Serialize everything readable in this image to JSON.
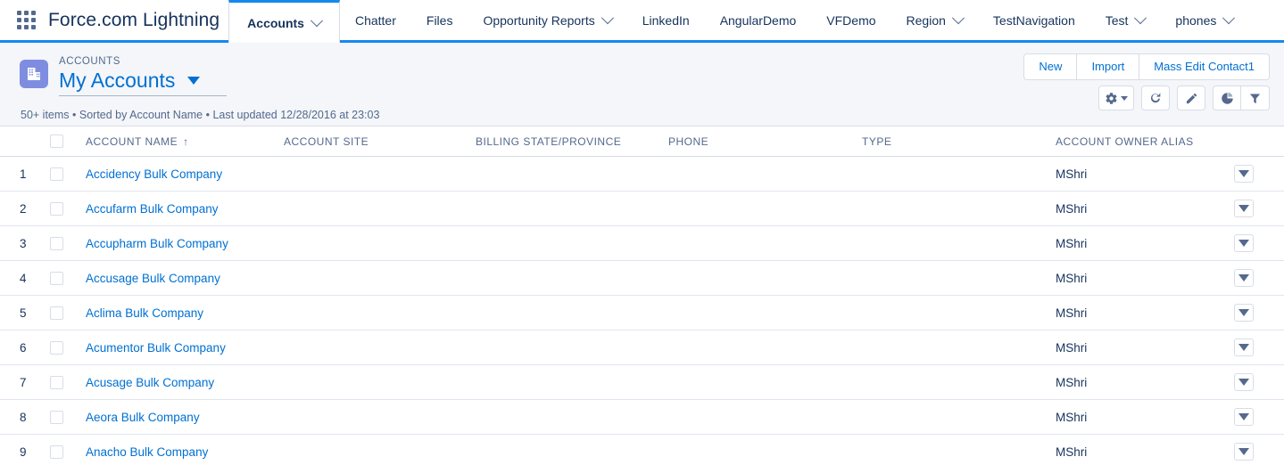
{
  "globalnav": {
    "app_launcher_icon": "app-launcher-grid-icon",
    "brand": "Force.com Lightning",
    "tabs": [
      {
        "label": "Accounts",
        "has_menu": true,
        "active": true
      },
      {
        "label": "Chatter",
        "has_menu": false,
        "active": false
      },
      {
        "label": "Files",
        "has_menu": false,
        "active": false
      },
      {
        "label": "Opportunity Reports",
        "has_menu": true,
        "active": false
      },
      {
        "label": "LinkedIn",
        "has_menu": false,
        "active": false
      },
      {
        "label": "AngularDemo",
        "has_menu": false,
        "active": false
      },
      {
        "label": "VFDemo",
        "has_menu": false,
        "active": false
      },
      {
        "label": "Region",
        "has_menu": true,
        "active": false
      },
      {
        "label": "TestNavigation",
        "has_menu": false,
        "active": false
      },
      {
        "label": "Test",
        "has_menu": true,
        "active": false
      },
      {
        "label": "phones",
        "has_menu": true,
        "active": false
      }
    ]
  },
  "page_header": {
    "object_icon": "account-building-icon",
    "eyebrow": "ACCOUNTS",
    "title": "My Accounts",
    "meta": "50+ items • Sorted by Account Name • Last updated 12/28/2016 at 23:03",
    "buttons": [
      {
        "label": "New"
      },
      {
        "label": "Import"
      },
      {
        "label": "Mass Edit Contact1"
      }
    ],
    "tools": [
      {
        "icon": "gear-icon",
        "name": "list-view-controls"
      },
      {
        "icon": "refresh-icon",
        "name": "refresh"
      },
      {
        "icon": "pencil-icon",
        "name": "edit"
      },
      {
        "icon": "chart-icon",
        "name": "charts"
      },
      {
        "icon": "filter-icon",
        "name": "filters"
      }
    ]
  },
  "table": {
    "columns": [
      {
        "key": "num",
        "label": ""
      },
      {
        "key": "check",
        "label": ""
      },
      {
        "key": "name",
        "label": "ACCOUNT NAME",
        "sorted": "asc",
        "sort_glyph": "↑"
      },
      {
        "key": "site",
        "label": "ACCOUNT SITE"
      },
      {
        "key": "state",
        "label": "BILLING STATE/PROVINCE"
      },
      {
        "key": "phone",
        "label": "PHONE"
      },
      {
        "key": "type",
        "label": "TYPE"
      },
      {
        "key": "owner",
        "label": "ACCOUNT OWNER ALIAS"
      },
      {
        "key": "action",
        "label": ""
      }
    ],
    "rows": [
      {
        "num": "1",
        "name": "Accidency Bulk Company",
        "site": "",
        "state": "",
        "phone": "",
        "type": "",
        "owner": "MShri"
      },
      {
        "num": "2",
        "name": "Accufarm Bulk Company",
        "site": "",
        "state": "",
        "phone": "",
        "type": "",
        "owner": "MShri"
      },
      {
        "num": "3",
        "name": "Accupharm Bulk Company",
        "site": "",
        "state": "",
        "phone": "",
        "type": "",
        "owner": "MShri"
      },
      {
        "num": "4",
        "name": "Accusage Bulk Company",
        "site": "",
        "state": "",
        "phone": "",
        "type": "",
        "owner": "MShri"
      },
      {
        "num": "5",
        "name": "Aclima Bulk Company",
        "site": "",
        "state": "",
        "phone": "",
        "type": "",
        "owner": "MShri"
      },
      {
        "num": "6",
        "name": "Acumentor Bulk Company",
        "site": "",
        "state": "",
        "phone": "",
        "type": "",
        "owner": "MShri"
      },
      {
        "num": "7",
        "name": "Acusage Bulk Company",
        "site": "",
        "state": "",
        "phone": "",
        "type": "",
        "owner": "MShri"
      },
      {
        "num": "8",
        "name": "Aeora Bulk Company",
        "site": "",
        "state": "",
        "phone": "",
        "type": "",
        "owner": "MShri"
      },
      {
        "num": "9",
        "name": "Anacho Bulk Company",
        "site": "",
        "state": "",
        "phone": "",
        "type": "",
        "owner": "MShri"
      }
    ]
  },
  "colors": {
    "brand_blue": "#1589ee",
    "link_blue": "#0070d2",
    "text_navy": "#16325c",
    "muted": "#54698d",
    "header_bg": "#f4f6f9",
    "border": "#d8dde6",
    "object_icon_bg": "#7f8de1"
  }
}
